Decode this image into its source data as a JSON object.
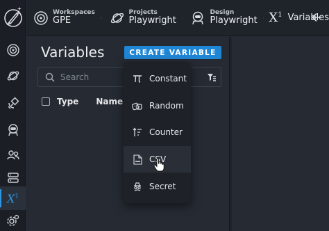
{
  "breadcrumbs": [
    {
      "label": "Workspaces",
      "value": "GPE",
      "icon": "workspace-icon"
    },
    {
      "label": "Projects",
      "value": "Playwright",
      "icon": "planet-icon"
    },
    {
      "label": "Design",
      "value": "Playwright",
      "icon": "astronaut-icon"
    }
  ],
  "current_page": {
    "symbol": "X",
    "superscript": "1",
    "label": "Variables"
  },
  "rail": {
    "items": [
      "workspace-icon",
      "planet-icon",
      "satellite-icon",
      "astronaut-icon",
      "users-icon",
      "servers-icon",
      "variables-icon",
      "settings-icon"
    ],
    "active": "variables-icon",
    "active_label": {
      "symbol": "X",
      "superscript": "1"
    }
  },
  "panel": {
    "title": "Variables",
    "create_button": "CREATE VARIABLE",
    "search_placeholder": "Search",
    "columns": {
      "type": "Type",
      "name": "Name"
    }
  },
  "menu": {
    "items": [
      {
        "label": "Constant",
        "icon": "pi-icon"
      },
      {
        "label": "Random",
        "icon": "dice-icon"
      },
      {
        "label": "Counter",
        "icon": "sort-arrow-icon"
      },
      {
        "label": "CSV",
        "icon": "csv-file-icon"
      },
      {
        "label": "Secret",
        "icon": "spy-icon"
      }
    ],
    "hovered": "CSV"
  },
  "colors": {
    "accent": "#1f86d6",
    "active_marker": "#2f95e0",
    "background": "#262b33",
    "rail": "#1b1f25",
    "menu": "#1e2228"
  }
}
